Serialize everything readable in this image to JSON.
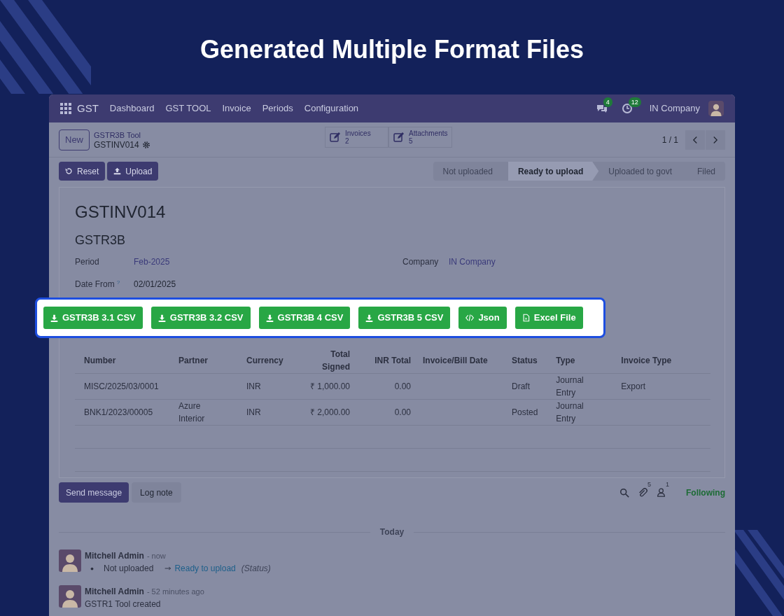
{
  "headline": "Generated Multiple Format Files",
  "navbar": {
    "app": "GST",
    "menu": [
      "Dashboard",
      "GST TOOL",
      "Invoice",
      "Periods",
      "Configuration"
    ],
    "messages_count": "4",
    "activities_count": "12",
    "company": "IN Company"
  },
  "control_panel": {
    "new_button": "New",
    "breadcrumb": "GSTR3B Tool",
    "record": "GSTINV014",
    "smart_buttons": [
      {
        "label": "Invoices",
        "count": "2"
      },
      {
        "label": "Attachments",
        "count": "5"
      }
    ],
    "pager": "1 / 1"
  },
  "actions": [
    {
      "label": "Reset",
      "kind": "reset"
    },
    {
      "label": "Upload",
      "kind": "upload"
    }
  ],
  "statusbar": [
    {
      "label": "Not uploaded",
      "selected": false
    },
    {
      "label": "Ready to upload",
      "selected": true
    },
    {
      "label": "Uploaded to govt",
      "selected": false
    },
    {
      "label": "Filed",
      "selected": false
    }
  ],
  "form": {
    "title": "GSTINV014",
    "subtitle": "GSTR3B",
    "left_fields": [
      {
        "label": "Period",
        "value": "Feb-2025",
        "kind": "link"
      },
      {
        "label": "Date From",
        "help": "?",
        "value": "02/01/2025",
        "kind": "text"
      }
    ],
    "right_fields": [
      {
        "label": "Company",
        "value": "IN Company",
        "kind": "link"
      }
    ]
  },
  "export_buttons": [
    {
      "label": "GSTR3B 3.1 CSV",
      "kind": "download"
    },
    {
      "label": "GSTR3B 3.2 CSV",
      "kind": "download"
    },
    {
      "label": "GSTR3B 4 CSV",
      "kind": "download"
    },
    {
      "label": "GSTR3B 5 CSV",
      "kind": "download"
    },
    {
      "label": "Json",
      "kind": "code"
    },
    {
      "label": "Excel File",
      "kind": "file"
    }
  ],
  "table": {
    "columns": [
      "Number",
      "Partner",
      "Currency",
      "Total Signed",
      "INR Total",
      "Invoice/Bill Date",
      "Status",
      "Type",
      "Invoice Type"
    ],
    "rows": [
      [
        "MISC/2025/03/0001",
        "",
        "INR",
        "₹ 1,000.00",
        "0.00",
        "",
        "Draft",
        "Journal Entry",
        "Export"
      ],
      [
        "BNK1/2023/00005",
        "Azure Interior",
        "INR",
        "₹ 2,000.00",
        "0.00",
        "",
        "Posted",
        "Journal Entry",
        ""
      ]
    ]
  },
  "chatter": {
    "send_button": "Send message",
    "log_button": "Log note",
    "attachments_count": "5",
    "followers_count": "1",
    "following": "Following",
    "date_separator": "Today",
    "messages": [
      {
        "author": "Mitchell Admin",
        "time": "- now",
        "kind": "tracking",
        "old_value": "Not uploaded",
        "new_value": "Ready to upload",
        "field": "(Status)"
      },
      {
        "author": "Mitchell Admin",
        "time": "- 52 minutes ago",
        "kind": "text",
        "body": "GSTR1 Tool created"
      }
    ]
  }
}
